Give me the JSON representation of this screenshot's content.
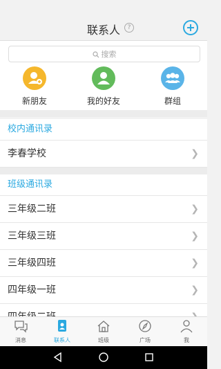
{
  "header": {
    "title": "联系人",
    "help_icon": "help-circle-icon",
    "add_icon": "plus-circle-icon",
    "accent": "#2ba9e0"
  },
  "search": {
    "placeholder": "搜索"
  },
  "quick_actions": [
    {
      "label": "新朋友",
      "icon": "person-add-icon",
      "color": "#f5b72c"
    },
    {
      "label": "我的好友",
      "icon": "person-icon",
      "color": "#62bb5b"
    },
    {
      "label": "群组",
      "icon": "group-icon",
      "color": "#5ab4e8"
    }
  ],
  "school_section": {
    "title": "校内通讯录",
    "items": [
      {
        "label": "李春学校"
      }
    ]
  },
  "class_section": {
    "title": "班级通讯录",
    "items": [
      {
        "label": "三年级二班"
      },
      {
        "label": "三年级三班"
      },
      {
        "label": "三年级四班"
      },
      {
        "label": "四年级一班"
      },
      {
        "label": "四年级二班"
      }
    ]
  },
  "tabbar": {
    "tabs": [
      {
        "label": "消息",
        "icon": "chat-icon",
        "active": false
      },
      {
        "label": "联系人",
        "icon": "contacts-icon",
        "active": true
      },
      {
        "label": "班级",
        "icon": "home-icon",
        "active": false
      },
      {
        "label": "广场",
        "icon": "compass-icon",
        "active": false
      },
      {
        "label": "我",
        "icon": "user-icon",
        "active": false
      }
    ]
  }
}
